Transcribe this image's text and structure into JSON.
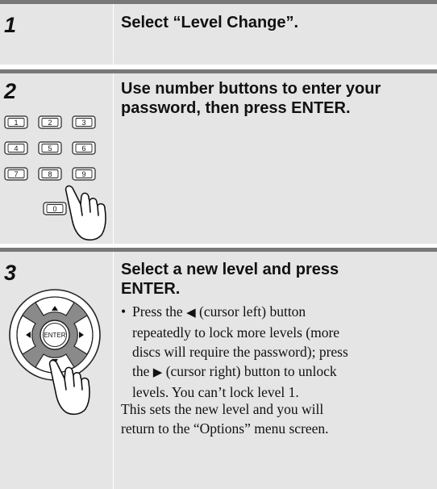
{
  "steps": [
    {
      "number": "1",
      "heading": "Select “Level Change”."
    },
    {
      "number": "2",
      "heading_lines": [
        "Use number buttons to enter your",
        "password, then press ENTER."
      ],
      "keypad": [
        "1",
        "2",
        "3",
        "4",
        "5",
        "6",
        "7",
        "8",
        "9",
        "0"
      ]
    },
    {
      "number": "3",
      "heading_lines": [
        "Select a new level and press",
        "ENTER."
      ],
      "enter_label": "ENTER",
      "bullet": {
        "line1_pre": "Press the ",
        "line1_glyph": "◀",
        "line1_post": " (cursor left) button",
        "line2": "repeatedly to lock more levels (more",
        "line3": "discs will require the password); press",
        "line4_pre": "the ",
        "line4_glyph": "▶",
        "line4_post": " (cursor right) button to unlock",
        "line5": "levels. You can’t lock level 1."
      },
      "note_lines": [
        "This sets the new level and you will",
        "return to the “Options” menu screen."
      ]
    }
  ]
}
